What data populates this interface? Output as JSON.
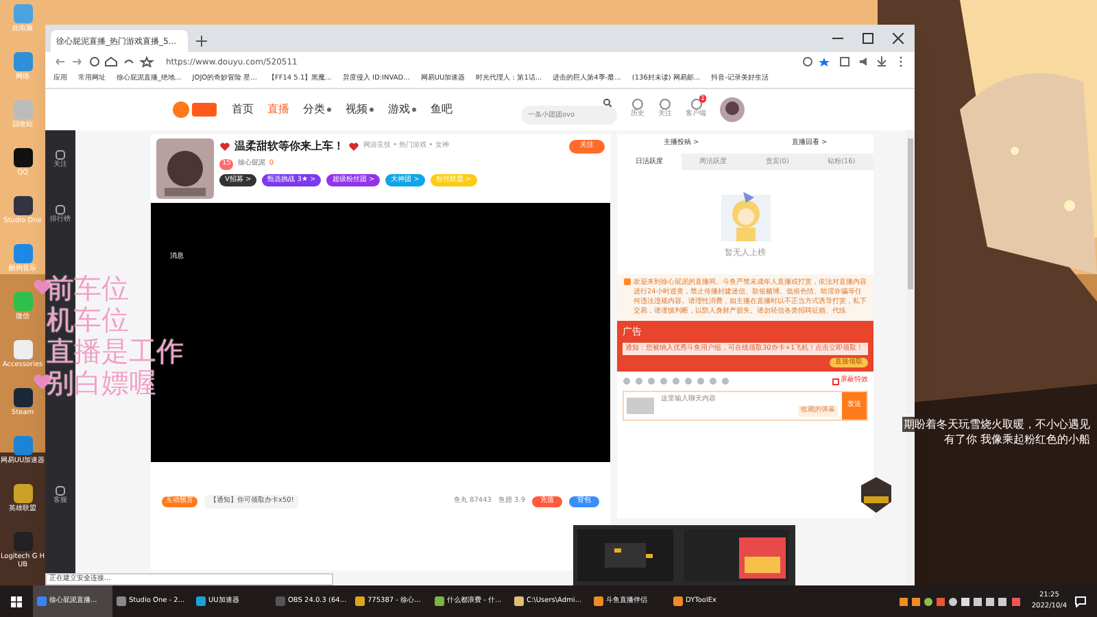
{
  "desktop": {
    "icons": [
      {
        "label": "此电脑"
      },
      {
        "label": "网络"
      },
      {
        "label": "回收站"
      },
      {
        "label": "QQ"
      },
      {
        "label": "Studio One"
      },
      {
        "label": "酷狗音乐"
      },
      {
        "label": "微信"
      },
      {
        "label": "Accessories"
      },
      {
        "label": "Steam"
      },
      {
        "label": "网易UU加速器"
      },
      {
        "label": "英雄联盟"
      },
      {
        "label": "Logitech G HUB"
      }
    ],
    "overlay_lines": [
      "前车位",
      "机车位",
      "直播是工作",
      "别白嫖喔"
    ],
    "subtitles": [
      "期盼着冬天玩雪烧火取暖，不小心遇见",
      "有了你  我像乘起粉红色的小船"
    ]
  },
  "browser": {
    "tab": {
      "title": "徐心屁泥直播_热门游戏直播_5..."
    },
    "url": "https://www.douyu.com/520511",
    "bookmarks": [
      "应用",
      "常用网址",
      "徐心屁泥直播_绝地...",
      "JOJO的奇妙冒险 星...",
      "【FF14 5.1】黑魔...",
      "异度侵入 ID:INVAD...",
      "网易UU加速器",
      "时光代理人：第1话...",
      "进击的巨人第4季-最...",
      "(136封未读) 网易邮...",
      "抖音-记录美好生活"
    ],
    "status": "正在建立安全连接..."
  },
  "site": {
    "nav": [
      {
        "label": "首页",
        "selected": false,
        "dropdown": false
      },
      {
        "label": "直播",
        "selected": true,
        "dropdown": false
      },
      {
        "label": "分类",
        "selected": false,
        "dropdown": true
      },
      {
        "label": "视频",
        "selected": false,
        "dropdown": true
      },
      {
        "label": "游戏",
        "selected": false,
        "dropdown": true
      },
      {
        "label": "鱼吧",
        "selected": false,
        "dropdown": false
      }
    ],
    "search": {
      "placeholder": "一条小团团ovo"
    },
    "header_icons": [
      {
        "label": "历史"
      },
      {
        "label": "关注"
      },
      {
        "label": "客户端",
        "badge": "1"
      }
    ],
    "sidebar": [
      "关注",
      "排行榜",
      "客服"
    ]
  },
  "stream": {
    "title": "温柔甜软等你来上车！",
    "breadcrumb": "网游竞技 • 热门游戏 • 女神",
    "follow": "关注",
    "level": "15",
    "streamer": "徐心屁泥",
    "heat": "0",
    "tags": [
      {
        "label": "V招募 >",
        "color": "#333333"
      },
      {
        "label": "甄选挑战 3★ >",
        "color": "#7c3aed"
      },
      {
        "label": "超级粉丝团 >",
        "color": "#9333ea"
      },
      {
        "label": "大神团 >",
        "color": "#0ea5e9"
      },
      {
        "label": "粉丝联盟 >",
        "color": "#facc15"
      }
    ],
    "video_text": "消息",
    "prediction": "互动预言",
    "notice": "【通知】你可领取办卡x50!",
    "fish_balls": "鱼丸 87443",
    "fish_fins": "鱼翅 3.9",
    "recharge": "充值",
    "backpack": "背包"
  },
  "panel": {
    "links": [
      "主播投稿 >",
      "直播回看 >"
    ],
    "tabs": [
      {
        "label": "日活跃度",
        "selected": true
      },
      {
        "label": "周活跃度",
        "selected": false
      },
      {
        "label": "贵宾(0)",
        "selected": false
      },
      {
        "label": "钻粉(16)",
        "selected": false
      }
    ],
    "empty": "暂无人上榜",
    "welcome": "欢迎来到徐心屁泥的直播间。斗鱼严禁未成年人直播或打赏，依法对直播内容进行24小时巡查，禁止传播封建迷信、歌俗赌博、低俗色情、暗淫诈骗等任何违法违规内容。请理性消费，如主播在直播时以不正当方式诱导打赏，私下交易，请谨慎判断，以防人身财产损失。请勿轻信各类招聘征婚、代练",
    "ad": {
      "label": "广告",
      "text": "通知：您被纳入优秀斗鱼用户组，可在线领取30办卡+1飞机！点击立即领取！",
      "button": "直接领取"
    },
    "block_effects": {
      "label": "屏蔽特效",
      "checked": false
    },
    "chat": {
      "placeholder": "这里输入聊天内容",
      "saved": "收藏的弹幕",
      "send": "发送"
    }
  },
  "taskbar": {
    "items": [
      {
        "label": "徐心屁泥直播...",
        "selected": true
      },
      {
        "label": "Studio One - 2...",
        "selected": false
      },
      {
        "label": "UU加速器",
        "selected": false
      },
      {
        "label": "OBS 24.0.3 (64...",
        "selected": false
      },
      {
        "label": "775387 - 徐心...",
        "selected": false
      },
      {
        "label": "什么都浪费 - 什...",
        "selected": false
      },
      {
        "label": "C:\\Users\\Admi...",
        "selected": false
      },
      {
        "label": "斗鱼直播伴侣",
        "selected": false
      },
      {
        "label": "DYToolEx",
        "selected": false
      }
    ],
    "time": "21:25",
    "date": "2022/10/4"
  }
}
